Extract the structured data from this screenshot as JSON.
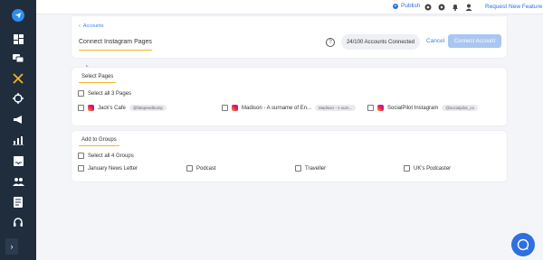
{
  "colors": {
    "sidebar": "#1f2d3d",
    "accent": "#2f6fe0",
    "highlight": "#f5b323"
  },
  "sidebar": {
    "icons": [
      "paper-plane-icon",
      "dashboard-icon",
      "comments-icon",
      "cross-arrows-icon",
      "target-icon",
      "megaphone-icon",
      "analytics-icon",
      "inbox-icon",
      "team-icon",
      "document-icon",
      "headset-icon"
    ],
    "expand_label": "›"
  },
  "topbar": {
    "publish_label": "Publish",
    "request_feature_label": "Request New Feature"
  },
  "header": {
    "back_label": "Accounts",
    "title": "Connect Instagram Pages",
    "help_label": "?",
    "accounts_connected": "24/100 Accounts Connected",
    "cancel_label": "Cancel",
    "connect_label": "Connect Account"
  },
  "pages": {
    "title": "Select Pages",
    "select_all": "Select all 3 Pages",
    "items": [
      {
        "name": "Jack's Cafe",
        "handle": "@fatspeedbump"
      },
      {
        "name": "Madison - A surname of En...",
        "handle": "Madison - A surn..."
      },
      {
        "name": "SocialPilot Instagram",
        "handle": "@socialpilot_co"
      }
    ]
  },
  "groups": {
    "title": "Add to Groups",
    "select_all": "Select all 4 Groups",
    "items": [
      "January News Letter",
      "Podcast",
      "Traveller",
      "UK's Podcaster"
    ]
  }
}
